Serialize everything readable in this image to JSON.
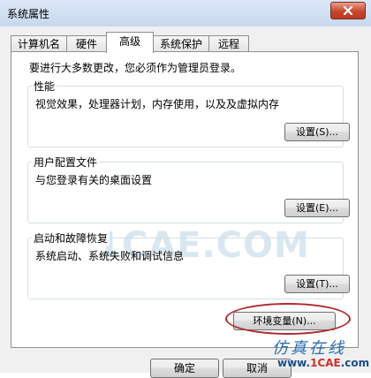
{
  "window": {
    "title": "系统属性"
  },
  "tabs": [
    {
      "label": "计算机名"
    },
    {
      "label": "硬件"
    },
    {
      "label": "高级",
      "active": true
    },
    {
      "label": "系统保护"
    },
    {
      "label": "远程"
    }
  ],
  "notice": "要进行大多数更改，您必须作为管理员登录。",
  "groups": {
    "performance": {
      "title": "性能",
      "description": "视觉效果，处理器计划，内存使用，以及及虚拟内存",
      "button": "设置(S)..."
    },
    "user_profiles": {
      "title": "用户配置文件",
      "description": "与您登录有关的桌面设置",
      "button": "设置(E)..."
    },
    "startup_recovery": {
      "title": "启动和故障恢复",
      "description": "系统启动、系统失败和调试信息",
      "button": "设置(T)..."
    }
  },
  "env_button": "环境变量(N)...",
  "footer": {
    "ok": "确定",
    "cancel": "取消"
  },
  "watermark": "1CAE.COM",
  "brand": {
    "cn": "仿真在线",
    "url_prefix": "www.",
    "url_accent": "1CAE",
    "url_suffix": ".com"
  },
  "colors": {
    "highlight_ellipse": "#b22a2a",
    "close_button": "#c9452c"
  }
}
